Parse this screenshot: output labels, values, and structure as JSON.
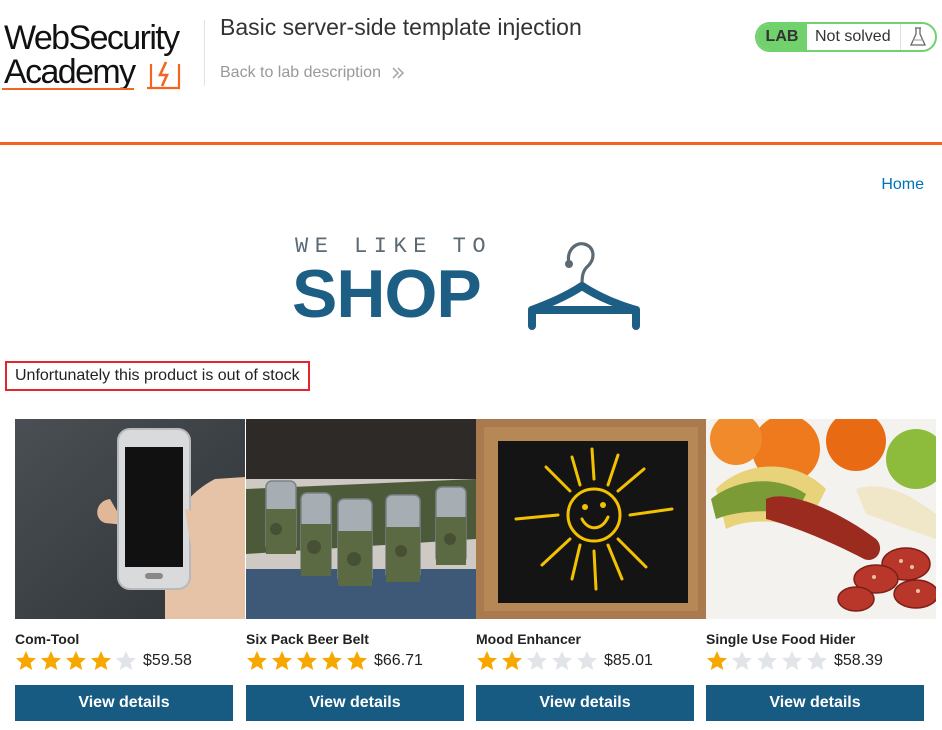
{
  "header": {
    "logo_line1": "WebSecurity",
    "logo_line2": "Academy",
    "lab_title": "Basic server-side template injection",
    "back_link": "Back to lab description",
    "lab_badge": "LAB",
    "lab_status": "Not solved"
  },
  "nav": {
    "home": "Home"
  },
  "shop_logo": {
    "tagline": "WE LIKE TO",
    "word": "SHOP"
  },
  "notice": "Unfortunately this product is out of stock",
  "products": [
    {
      "name": "Com-Tool",
      "rating": 4,
      "price": "$59.58",
      "button": "View details"
    },
    {
      "name": "Six Pack Beer Belt",
      "rating": 5,
      "price": "$66.71",
      "button": "View details"
    },
    {
      "name": "Mood Enhancer",
      "rating": 2,
      "price": "$85.01",
      "button": "View details"
    },
    {
      "name": "Single Use Food Hider",
      "rating": 1,
      "price": "$58.39",
      "button": "View details"
    }
  ],
  "colors": {
    "brand_orange": "#f26522",
    "lab_green": "#70d16d",
    "button_blue": "#175a82",
    "link_blue": "#0071bc",
    "star_filled": "#f7a800",
    "star_empty": "#e1e4e8",
    "notice_border": "#e0272e"
  }
}
